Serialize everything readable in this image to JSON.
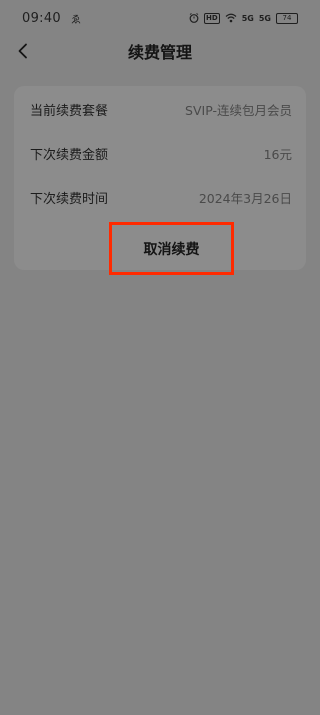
{
  "status_bar": {
    "time": "09:40",
    "app_indicator": "ゑ",
    "hd": "HD",
    "signal1": "5G",
    "signal2": "5G",
    "battery": "74"
  },
  "nav": {
    "title": "续费管理"
  },
  "renewal": {
    "rows": [
      {
        "label": "当前续费套餐",
        "value": "SVIP-连续包月会员"
      },
      {
        "label": "下次续费金额",
        "value": "16元"
      },
      {
        "label": "下次续费时间",
        "value": "2024年3月26日"
      }
    ],
    "cancel_label": "取消续费"
  },
  "colors": {
    "overlay_bg": "#848484",
    "highlight": "#ff2a00"
  }
}
